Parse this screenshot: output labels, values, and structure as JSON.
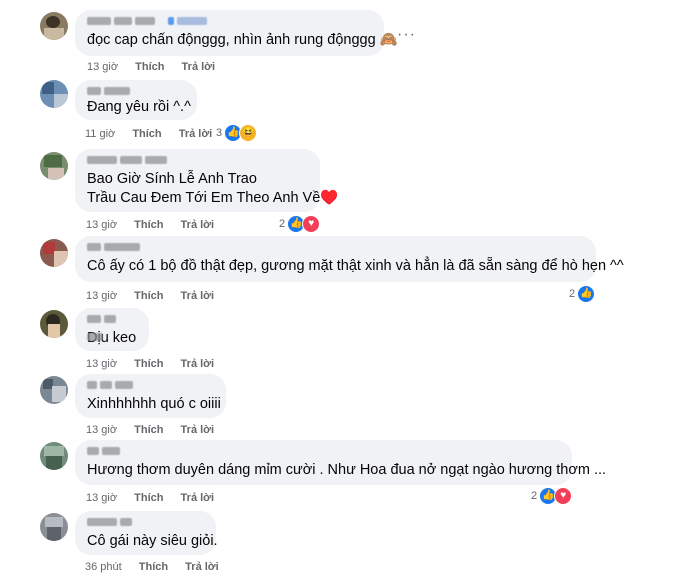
{
  "more_label": "···",
  "comments": [
    {
      "text1": "đọc cap chấn độnggg, nhìn ảnh rung độnggg 🙈",
      "time": "13 giờ",
      "like": "Thích",
      "reply": "Trả lời",
      "reactions": {
        "count": "",
        "icons": []
      }
    },
    {
      "text1": "Đang yêu rồi ^.^",
      "time": "11 giờ",
      "like": "Thích",
      "reply": "Trả lời",
      "reactions": {
        "count": "3",
        "icons": [
          "like-icon",
          "haha-icon"
        ]
      }
    },
    {
      "text1": "Bao Giờ Sính Lễ Anh Trao",
      "text2": "Trầu Cau Đem Tới Em Theo Anh Về♥️",
      "time": "13 giờ",
      "like": "Thích",
      "reply": "Trả lời",
      "reactions": {
        "count": "2",
        "icons": [
          "like-icon",
          "heart-icon"
        ]
      }
    },
    {
      "text1": "Cô ấy có 1 bộ đồ thật đẹp, gương mặt thật xinh và hẳn là đã sẵn sàng để hò hẹn ^^",
      "time": "13 giờ",
      "like": "Thích",
      "reply": "Trả lời",
      "reactions": {
        "count": "2",
        "icons": [
          "like-icon"
        ]
      }
    },
    {
      "text1": "Dịu keo",
      "time": "13 giờ",
      "like": "Thích",
      "reply": "Trả lời",
      "reactions": {
        "count": "",
        "icons": []
      }
    },
    {
      "text1": "Xinhhhhhh quó c oiiii",
      "time": "13 giờ",
      "like": "Thích",
      "reply": "Trả lời",
      "reactions": {
        "count": "",
        "icons": []
      }
    },
    {
      "text1": "Hương thơm duyên dáng mỉm cười . Như Hoa đua nở ngạt ngào hương thơm ...",
      "time": "13 giờ",
      "like": "Thích",
      "reply": "Trả lời",
      "reactions": {
        "count": "2",
        "icons": [
          "like-icon",
          "heart-icon"
        ]
      }
    },
    {
      "text1": "Cô gái này siêu giỏi.",
      "time": "36 phút",
      "like": "Thích",
      "reply": "Trả lời",
      "reactions": {
        "count": "",
        "icons": []
      }
    }
  ],
  "colors": {
    "bubble": "#f0f2f5",
    "meta": "#65676b",
    "like": "#1877f2",
    "heart": "#f33e58"
  }
}
